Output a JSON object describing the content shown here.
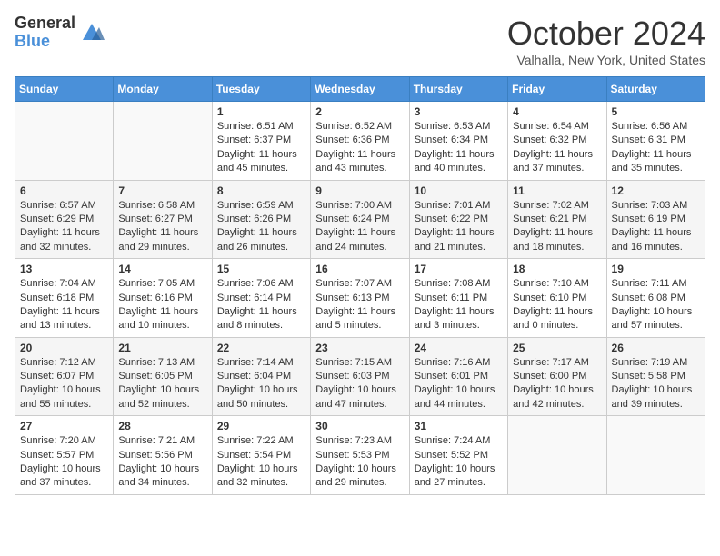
{
  "header": {
    "logo_general": "General",
    "logo_blue": "Blue",
    "title": "October 2024",
    "location": "Valhalla, New York, United States"
  },
  "days_of_week": [
    "Sunday",
    "Monday",
    "Tuesday",
    "Wednesday",
    "Thursday",
    "Friday",
    "Saturday"
  ],
  "weeks": [
    [
      {
        "day": "",
        "info": ""
      },
      {
        "day": "",
        "info": ""
      },
      {
        "day": "1",
        "info": "Sunrise: 6:51 AM\nSunset: 6:37 PM\nDaylight: 11 hours and 45 minutes."
      },
      {
        "day": "2",
        "info": "Sunrise: 6:52 AM\nSunset: 6:36 PM\nDaylight: 11 hours and 43 minutes."
      },
      {
        "day": "3",
        "info": "Sunrise: 6:53 AM\nSunset: 6:34 PM\nDaylight: 11 hours and 40 minutes."
      },
      {
        "day": "4",
        "info": "Sunrise: 6:54 AM\nSunset: 6:32 PM\nDaylight: 11 hours and 37 minutes."
      },
      {
        "day": "5",
        "info": "Sunrise: 6:56 AM\nSunset: 6:31 PM\nDaylight: 11 hours and 35 minutes."
      }
    ],
    [
      {
        "day": "6",
        "info": "Sunrise: 6:57 AM\nSunset: 6:29 PM\nDaylight: 11 hours and 32 minutes."
      },
      {
        "day": "7",
        "info": "Sunrise: 6:58 AM\nSunset: 6:27 PM\nDaylight: 11 hours and 29 minutes."
      },
      {
        "day": "8",
        "info": "Sunrise: 6:59 AM\nSunset: 6:26 PM\nDaylight: 11 hours and 26 minutes."
      },
      {
        "day": "9",
        "info": "Sunrise: 7:00 AM\nSunset: 6:24 PM\nDaylight: 11 hours and 24 minutes."
      },
      {
        "day": "10",
        "info": "Sunrise: 7:01 AM\nSunset: 6:22 PM\nDaylight: 11 hours and 21 minutes."
      },
      {
        "day": "11",
        "info": "Sunrise: 7:02 AM\nSunset: 6:21 PM\nDaylight: 11 hours and 18 minutes."
      },
      {
        "day": "12",
        "info": "Sunrise: 7:03 AM\nSunset: 6:19 PM\nDaylight: 11 hours and 16 minutes."
      }
    ],
    [
      {
        "day": "13",
        "info": "Sunrise: 7:04 AM\nSunset: 6:18 PM\nDaylight: 11 hours and 13 minutes."
      },
      {
        "day": "14",
        "info": "Sunrise: 7:05 AM\nSunset: 6:16 PM\nDaylight: 11 hours and 10 minutes."
      },
      {
        "day": "15",
        "info": "Sunrise: 7:06 AM\nSunset: 6:14 PM\nDaylight: 11 hours and 8 minutes."
      },
      {
        "day": "16",
        "info": "Sunrise: 7:07 AM\nSunset: 6:13 PM\nDaylight: 11 hours and 5 minutes."
      },
      {
        "day": "17",
        "info": "Sunrise: 7:08 AM\nSunset: 6:11 PM\nDaylight: 11 hours and 3 minutes."
      },
      {
        "day": "18",
        "info": "Sunrise: 7:10 AM\nSunset: 6:10 PM\nDaylight: 11 hours and 0 minutes."
      },
      {
        "day": "19",
        "info": "Sunrise: 7:11 AM\nSunset: 6:08 PM\nDaylight: 10 hours and 57 minutes."
      }
    ],
    [
      {
        "day": "20",
        "info": "Sunrise: 7:12 AM\nSunset: 6:07 PM\nDaylight: 10 hours and 55 minutes."
      },
      {
        "day": "21",
        "info": "Sunrise: 7:13 AM\nSunset: 6:05 PM\nDaylight: 10 hours and 52 minutes."
      },
      {
        "day": "22",
        "info": "Sunrise: 7:14 AM\nSunset: 6:04 PM\nDaylight: 10 hours and 50 minutes."
      },
      {
        "day": "23",
        "info": "Sunrise: 7:15 AM\nSunset: 6:03 PM\nDaylight: 10 hours and 47 minutes."
      },
      {
        "day": "24",
        "info": "Sunrise: 7:16 AM\nSunset: 6:01 PM\nDaylight: 10 hours and 44 minutes."
      },
      {
        "day": "25",
        "info": "Sunrise: 7:17 AM\nSunset: 6:00 PM\nDaylight: 10 hours and 42 minutes."
      },
      {
        "day": "26",
        "info": "Sunrise: 7:19 AM\nSunset: 5:58 PM\nDaylight: 10 hours and 39 minutes."
      }
    ],
    [
      {
        "day": "27",
        "info": "Sunrise: 7:20 AM\nSunset: 5:57 PM\nDaylight: 10 hours and 37 minutes."
      },
      {
        "day": "28",
        "info": "Sunrise: 7:21 AM\nSunset: 5:56 PM\nDaylight: 10 hours and 34 minutes."
      },
      {
        "day": "29",
        "info": "Sunrise: 7:22 AM\nSunset: 5:54 PM\nDaylight: 10 hours and 32 minutes."
      },
      {
        "day": "30",
        "info": "Sunrise: 7:23 AM\nSunset: 5:53 PM\nDaylight: 10 hours and 29 minutes."
      },
      {
        "day": "31",
        "info": "Sunrise: 7:24 AM\nSunset: 5:52 PM\nDaylight: 10 hours and 27 minutes."
      },
      {
        "day": "",
        "info": ""
      },
      {
        "day": "",
        "info": ""
      }
    ]
  ]
}
